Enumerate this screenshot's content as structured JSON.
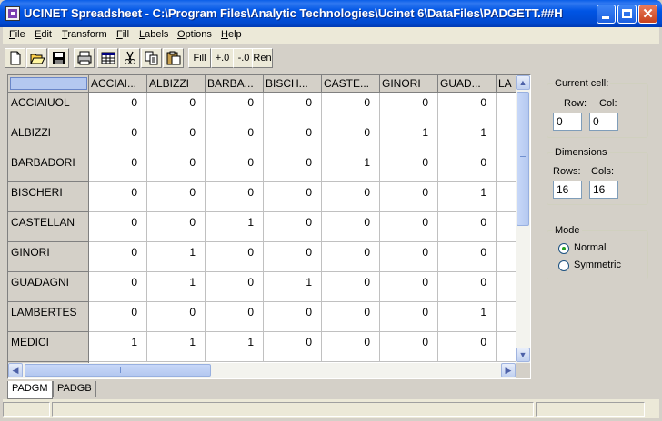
{
  "window": {
    "title": "UCINET Spreadsheet - C:\\Program Files\\Analytic Technologies\\Ucinet 6\\DataFiles\\PADGETT.##H",
    "close_glyph": "✕"
  },
  "menu": [
    {
      "u": "F",
      "rest": "ile"
    },
    {
      "u": "E",
      "rest": "dit"
    },
    {
      "u": "T",
      "rest": "ransform"
    },
    {
      "u": "F",
      "rest": "ill"
    },
    {
      "u": "L",
      "rest": "abels"
    },
    {
      "u": "O",
      "rest": "ptions"
    },
    {
      "u": "H",
      "rest": "elp"
    }
  ],
  "toolbar": {
    "icons": [
      "new-file-icon",
      "open-folder-icon",
      "save-disk-icon",
      "print-icon",
      "matrix-icon",
      "cut-scissors-icon",
      "copy-icon",
      "paste-icon"
    ],
    "fill_label": "Fill",
    "plus_label": "+.0",
    "minus_label": "-.0",
    "ren_label": "Ren"
  },
  "grid": {
    "columns": [
      "ACCIAI...",
      "ALBIZZI",
      "BARBA...",
      "BISCH...",
      "CASTE...",
      "GINORI",
      "GUAD...",
      "LA"
    ],
    "rows": [
      {
        "label": "ACCIAIUOL",
        "values": [
          "0",
          "0",
          "0",
          "0",
          "0",
          "0",
          "0"
        ]
      },
      {
        "label": "ALBIZZI",
        "values": [
          "0",
          "0",
          "0",
          "0",
          "0",
          "1",
          "1"
        ]
      },
      {
        "label": "BARBADORI",
        "values": [
          "0",
          "0",
          "0",
          "0",
          "1",
          "0",
          "0"
        ]
      },
      {
        "label": "BISCHERI",
        "values": [
          "0",
          "0",
          "0",
          "0",
          "0",
          "0",
          "1"
        ]
      },
      {
        "label": "CASTELLAN",
        "values": [
          "0",
          "0",
          "1",
          "0",
          "0",
          "0",
          "0"
        ]
      },
      {
        "label": "GINORI",
        "values": [
          "0",
          "1",
          "0",
          "0",
          "0",
          "0",
          "0"
        ]
      },
      {
        "label": "GUADAGNI",
        "values": [
          "0",
          "1",
          "0",
          "1",
          "0",
          "0",
          "0"
        ]
      },
      {
        "label": "LAMBERTES",
        "values": [
          "0",
          "0",
          "0",
          "0",
          "0",
          "0",
          "1"
        ]
      },
      {
        "label": "MEDICI",
        "values": [
          "1",
          "1",
          "1",
          "0",
          "0",
          "0",
          "0"
        ]
      }
    ]
  },
  "scroll": {
    "up": "▲",
    "down": "▼",
    "left": "◀",
    "right": "▶"
  },
  "sheets": [
    {
      "label": "PADGM",
      "active": true
    },
    {
      "label": "PADGB",
      "active": false
    }
  ],
  "panel": {
    "current_cell_title": "Current cell:",
    "row_label": "Row:",
    "col_label": "Col:",
    "row_value": "0",
    "col_value": "0",
    "dimensions_title": "Dimensions",
    "rows_label": "Rows:",
    "cols_label": "Cols:",
    "rows_value": "16",
    "cols_value": "16",
    "mode_title": "Mode",
    "mode_normal": "Normal",
    "mode_symmetric": "Symmetric",
    "selected_mode": "Normal"
  }
}
